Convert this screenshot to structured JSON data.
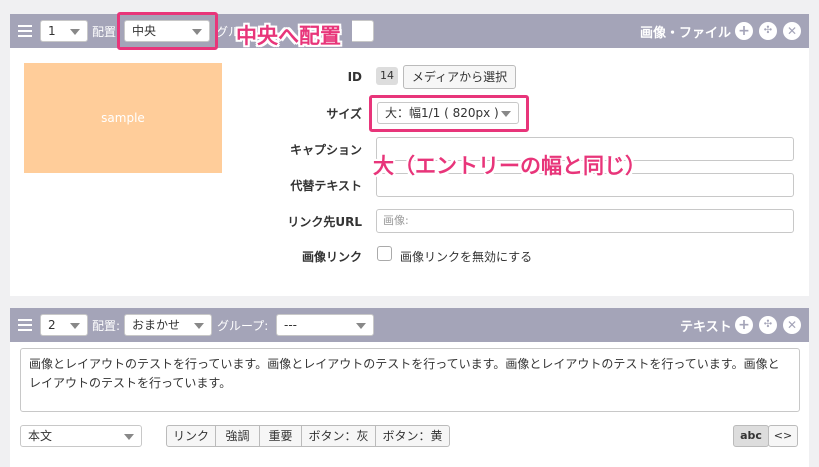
{
  "unit1": {
    "number": "1",
    "placement_label": "配置",
    "placement_value": "中央",
    "group_label_fragment": "グル",
    "title": "画像・ファイル",
    "add_icon": "plus-circle-icon",
    "move_icon": "move-circle-icon",
    "close_icon": "close-circle-icon",
    "image_placeholder": "sample",
    "fields": {
      "id_label": "ID",
      "id_value": "14",
      "media_button": "メディアから選択",
      "size_label": "サイズ",
      "size_value": "大：幅1/1 ( 820px )",
      "caption_label": "キャプション",
      "caption_value": "",
      "alt_label": "代替テキスト",
      "alt_value": "",
      "link_label": "リンク先URL",
      "link_placeholder": "画像:",
      "image_link_label": "画像リンク",
      "image_link_checkbox": "画像リンクを無効にする"
    }
  },
  "unit2": {
    "number": "2",
    "placement_label": "配置:",
    "placement_value": "おまかせ",
    "group_label": "グループ:",
    "group_value": "---",
    "title": "テキスト",
    "body_text": "画像とレイアウトのテストを行っています。画像とレイアウトのテストを行っています。画像とレイアウトのテストを行っています。画像とレイアウトのテストを行っています。",
    "tag_value": "本文",
    "buttons": [
      "リンク",
      "強調",
      "重要",
      "ボタン：灰",
      "ボタン：黄"
    ],
    "abc_button": "abc",
    "code_button": "<>"
  },
  "annotations": {
    "center_note": "中央へ配置",
    "size_note": "大（エントリーの幅と同じ）",
    "color": "#e8357a"
  },
  "colors": {
    "unit_bar": "#a4a4b8",
    "image_placeholder": "#ffcd9a"
  }
}
